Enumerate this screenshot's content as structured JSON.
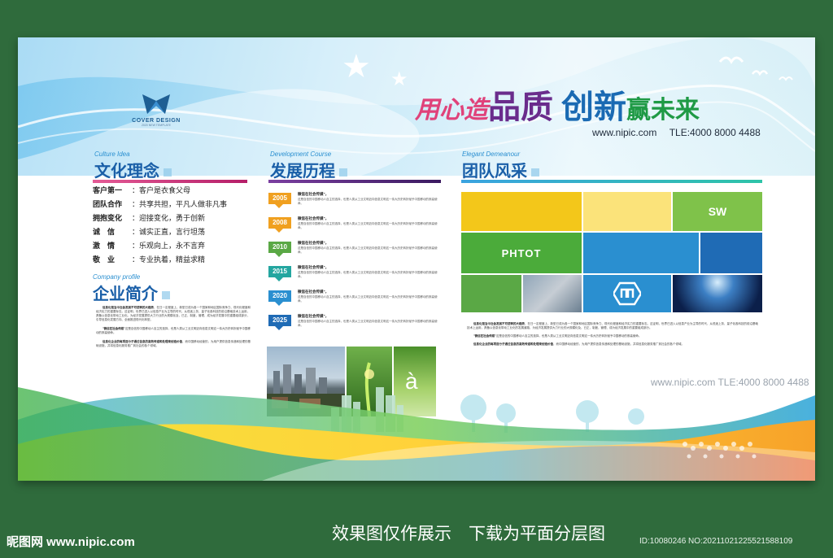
{
  "headline": {
    "part1": "用心造",
    "part2": "品质",
    "part3": "创新",
    "part4": "赢未来"
  },
  "contact": {
    "website": "www.nipic.com",
    "tel": "TLE:4000 8000 4488"
  },
  "logo": {
    "name": "COVER DESIGN",
    "sub": "2020 NEW TEMPLATE"
  },
  "sections": {
    "culture": {
      "en": "Culture Idea",
      "cn": "文化理念",
      "color": "#cc2a79"
    },
    "development": {
      "en": "Development Course",
      "cn": "发展历程",
      "color": "#6a2c8c"
    },
    "team": {
      "en": "Elegant Demeanour",
      "cn": "团队风采",
      "color": "#2a8fd0"
    },
    "company": {
      "en": "Company profile",
      "cn": "企业简介"
    }
  },
  "culture_items": [
    {
      "key": "客户第一",
      "value": "：客户是衣食父母"
    },
    {
      "key": "团队合作",
      "value": "：共享共担，平凡人做非凡事"
    },
    {
      "key": "拥抱变化",
      "value": "：迎接变化，勇于创新"
    },
    {
      "key": "诚　信",
      "value": "：诚实正直，言行坦荡"
    },
    {
      "key": "激　情",
      "value": "：乐观向上，永不言弃"
    },
    {
      "key": "敬　业",
      "value": "：专业执着，精益求精"
    }
  ],
  "timeline": [
    {
      "year": "2005",
      "color": "#f0a020",
      "title": "微信在社会传媒\"，",
      "desc": "这是自信的中国移动人自主的选择，也是人类从工业文明迈向信息文明这一伟大历史转折赋予中国移动的崇高使命。"
    },
    {
      "year": "2008",
      "color": "#f0a020",
      "title": "微信在社会传媒\"，",
      "desc": "这是自信的中国移动人自主的选择，也是人类从工业文明迈向信息文明这一伟大历史转折赋予中国移动的崇高使命。"
    },
    {
      "year": "2010",
      "color": "#5aa845",
      "title": "微信在社会传媒\"，",
      "desc": "这是自信的中国移动人自主的选择，也是人类从工业文明迈向信息文明这一伟大历史转折赋予中国移动的崇高使命。"
    },
    {
      "year": "2015",
      "color": "#24a6a0",
      "title": "微信在社会传媒\"，",
      "desc": "这是自信的中国移动人自主的选择，也是人类从工业文明迈向信息文明这一伟大历史转折赋予中国移动的崇高使命。"
    },
    {
      "year": "2020",
      "color": "#2a8fd0",
      "title": "微信在社会传媒\"，",
      "desc": "这是自信的中国移动人自主的选择，也是人类从工业文明迈向信息文明这一伟大历史转折赋予中国移动的崇高使命。"
    },
    {
      "year": "2025",
      "color": "#1f6bb5",
      "title": "微信在社会传媒\"，",
      "desc": "这是自信的中国移动人自主的选择，也是人类从工业文明迈向信息文明这一伟大历史转折赋予中国移动的崇高使命。"
    }
  ],
  "company_text": {
    "p1_bold": "信息化是当今社会发展不可逆转的大趋势",
    "p1": "，在日一定程度上，新型已成为各一个国家和地区国际竞争力、现代化程度和经济实力的重要标志。这证明，世界已进入以信息产业为主导的时代，从低迷上务、量子化各科技的前沿基础技术上运用，具备以信息化带动工业化。为经济发展提供大力行业的大规模化及，已正，制度，管理、成为经济发展中的重要组成部分，引导信息化发展方向、全面推进现代化转型。",
    "p2_bold": "\"微信在社会传媒\"",
    "p2": "这是自信的中国移动人自主的选择，也是人类从工业文明迈向信息文明这一伟大历史转折赋予中国移动的崇高使命。",
    "p3_bold": "信息化企业的每项目分子通过信息的高效传递和处理来创造价值",
    "p3": "，而中国移动经营的，为用户提供信息传递和处理的基础设施，并将信息化服务推广到社会的各个领域。"
  },
  "team_text": {
    "p1_bold": "信息化是当今社会发展不可逆转的大趋势",
    "p1": "，在日一定程度上，新型已成为各一个国家和地区国际竞争力、现代化程度和经济实力的重要标志。这证明，世界已进入以信息产业为主导的时代，从低迷上务、量子化各科技的前沿基础技术上运用，具备以信息化带动工业化的发展道路，为经济发展提供大力行业的大规模化及，已正，制度，管理、成为经济发展中的重要组成部分。",
    "p2_bold": "\"微信在社会传媒\"",
    "p2": "这是自信的中国移动人自主的选择，也是人类从工业文明迈向信息文明这一伟大历史转折赋予中国移动的崇高使命。",
    "p3_bold": "信息化企业的每项目分子通过信息的高效传递和处理来创造价值",
    "p3": "，而中国移动经营的，为用户提供信息传递和处理的基础设施，并将信息化服务推广到社会的各个领域。"
  },
  "team_tiles": {
    "sw": "SW",
    "phtot": "PHTOT"
  },
  "watermark": "www.nipic.com  TLE:4000 8000 4488",
  "footer": {
    "note": "效果图仅作展示　下载为平面分层图",
    "site_logo": "昵图网 www.nipic.com",
    "id": "ID:10080246 NO:20211021225521588109"
  }
}
